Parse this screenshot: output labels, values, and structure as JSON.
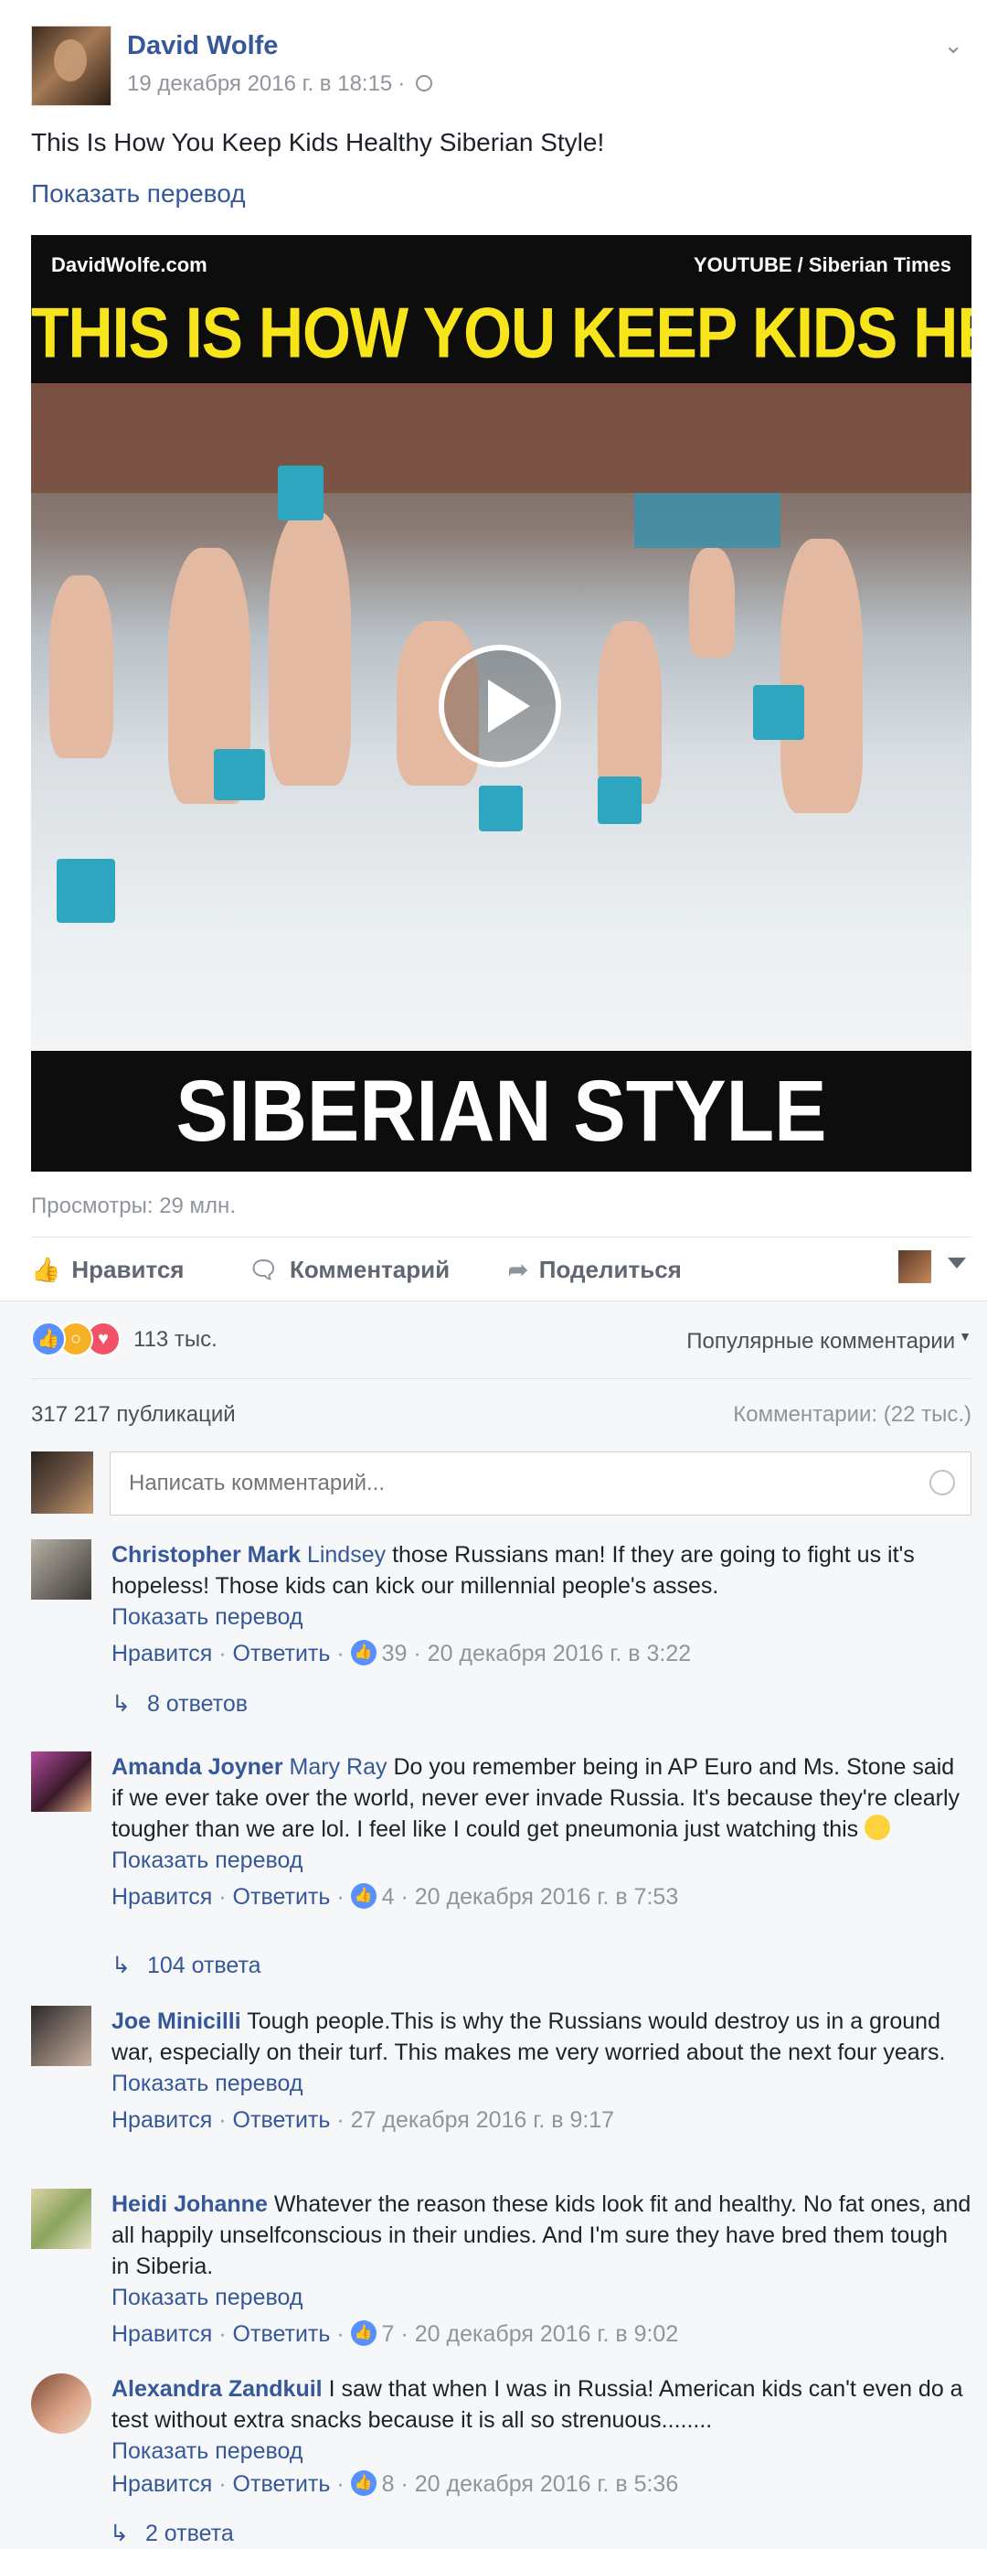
{
  "post": {
    "author": "David Wolfe",
    "timestamp": "19 декабря 2016 г. в 18:15",
    "privacy_icon": "globe-icon",
    "text": "This Is How You Keep Kids Healthy Siberian Style!",
    "translate_link": "Показать перевод"
  },
  "video": {
    "top_left": "DavidWolfe.com",
    "top_right": "YOUTUBE / Siberian Times",
    "headline": "THIS IS HOW YOU KEEP KIDS HEALTHY",
    "bottom_caption": "SIBERIAN STYLE",
    "views": "Просмотры: 29 млн."
  },
  "actions": {
    "like": "Нравится",
    "comment": "Комментарий",
    "share": "Поделиться"
  },
  "reactions": {
    "count": "113 тыс.",
    "popular_label": "Популярные комментарии",
    "shares": "317 217 публикаций",
    "comments_count": "Комментарии: (22 тыс.)",
    "input_placeholder": "Написать комментарий..."
  },
  "comments": [
    {
      "author": "Christopher Mark",
      "tag": "Lindsey",
      "text": "those Russians man! If they are going to fight us it's hopeless! Those kids can kick our millennial people's asses.",
      "translate": "Показать перевод",
      "like": "Нравится",
      "reply": "Ответить",
      "likes": "39",
      "time": "20 декабря 2016 г. в 3:22",
      "replies": "8 ответов"
    },
    {
      "author": "Amanda Joyner",
      "tag": "Mary Ray",
      "text": "Do you remember being in AP Euro and Ms. Stone said if we ever take over the world, never ever invade Russia. It's because they're clearly tougher than we are lol. I feel like I could get pneumonia just watching this",
      "translate": "Показать перевод",
      "like": "Нравится",
      "reply": "Ответить",
      "likes": "4",
      "time": "20 декабря 2016 г. в 7:53",
      "replies": "104 ответа"
    },
    {
      "author": "Joe Minicilli",
      "text": "Tough people.This is why the Russians would destroy us in a ground war, especially on their turf. This makes me very worried about the next four years.",
      "translate": "Показать перевод",
      "like": "Нравится",
      "reply": "Ответить",
      "time": "27 декабря 2016 г. в 9:17"
    },
    {
      "author": "Heidi Johanne",
      "text": "Whatever the reason these kids look fit and healthy. No fat ones, and all happily unselfconscious in their undies. And I'm sure they have bred them tough in Siberia.",
      "translate": "Показать перевод",
      "like": "Нравится",
      "reply": "Ответить",
      "likes": "7",
      "time": "20 декабря 2016 г. в 9:02"
    },
    {
      "author": "Alexandra Zandkuil",
      "text": "I saw that when I was in Russia! American kids can't even do a test without extra snacks because it is all so strenuous........",
      "translate": "Показать перевод",
      "like": "Нравится",
      "reply": "Ответить",
      "likes": "8",
      "time": "20 декабря 2016 г. в 5:36",
      "replies": "2 ответа"
    }
  ]
}
